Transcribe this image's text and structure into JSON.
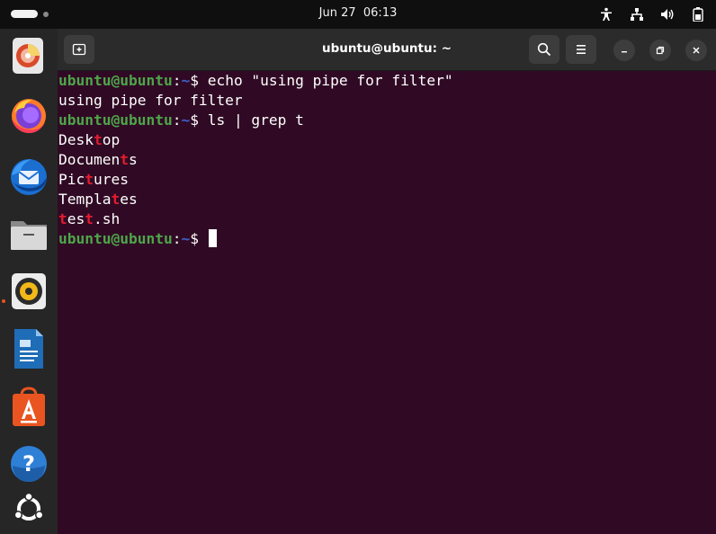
{
  "topbar": {
    "date": "Jun 27",
    "time": "06:13",
    "icons": [
      "accessibility-icon",
      "network-icon",
      "volume-icon",
      "battery-icon"
    ]
  },
  "dock": {
    "items": [
      "disk-usage-analyzer",
      "firefox",
      "thunderbird",
      "files",
      "rhythmbox",
      "libreoffice-writer",
      "app-center",
      "help",
      "show-apps"
    ],
    "accent": "#e95420"
  },
  "terminal": {
    "title": "ubuntu@ubuntu: ~",
    "prompt_user": "ubuntu@ubuntu",
    "prompt_sep": ":",
    "prompt_path": "~",
    "prompt_dollar": "$ ",
    "cmd1": "echo \"using pipe for filter\"",
    "out1": "using pipe for filter",
    "cmd2": "ls | grep t",
    "results": [
      {
        "pre": "Desk",
        "match": "t",
        "post": "op"
      },
      {
        "pre": "Documen",
        "match": "t",
        "post": "s"
      },
      {
        "pre": "Pic",
        "match": "t",
        "post": "ures"
      },
      {
        "pre": "Templa",
        "match": "t",
        "post": "es"
      },
      {
        "pre": "",
        "match": "t",
        "post": "es"
      }
    ],
    "results_extra": [
      ".sh"
    ],
    "colors": {
      "background": "#300a24",
      "user": "#4ea64a",
      "path": "#4060c8",
      "match": "#e21c2f"
    }
  }
}
